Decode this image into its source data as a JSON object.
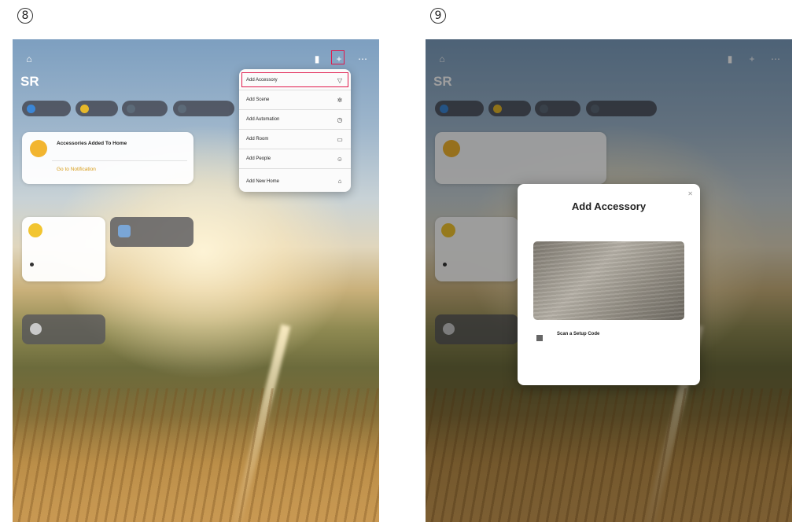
{
  "steps": {
    "left": "8",
    "right": "9"
  },
  "left_screen": {
    "home_title": "SR",
    "chips": [
      "",
      "",
      "",
      ""
    ],
    "notice": {
      "title": "Accessories Added To Home",
      "subtitle": "",
      "link": "Go to Notification"
    },
    "favorites_label": "",
    "home_label": "",
    "dark_tiles": [
      "",
      ""
    ],
    "add_menu": {
      "items": [
        {
          "label": "Add Accessory",
          "icon": "add-accessory-icon",
          "highlighted": true
        },
        {
          "label": "Add Scene",
          "icon": "scene-icon"
        },
        {
          "label": "Add Automation",
          "icon": "automation-icon"
        },
        {
          "label": "Add Room",
          "icon": "room-icon"
        },
        {
          "label": "Add People",
          "icon": "people-icon"
        },
        {
          "label": "Add New Home",
          "icon": "home-icon"
        }
      ]
    },
    "highlight_color": "#e0194b"
  },
  "right_screen": {
    "home_title": "SR",
    "modal": {
      "title": "Add Accessory",
      "subtitle": "",
      "more_link": "",
      "option_title": "Scan a Setup Code",
      "option_desc": ""
    },
    "accent_color": "#d8a21a"
  }
}
